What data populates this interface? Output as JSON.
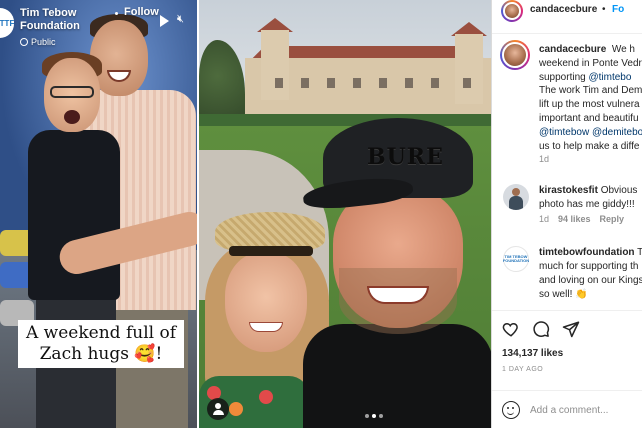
{
  "panel1": {
    "account_name": "Tim Tebow Foundation",
    "visibility": "Public",
    "follow_label": "Follow",
    "caption": "A weekend full of Zach hugs 🥰!",
    "avatar_mark": "TTF"
  },
  "panel2": {
    "cap_text": "BURE"
  },
  "panel3": {
    "header": {
      "username": "candacecbure",
      "separator": "•",
      "follow_label": "Fo"
    },
    "caption": {
      "username": "candacecbure",
      "lines": [
        [
          "We h"
        ],
        [
          "weekend in Ponte Vedr"
        ],
        [
          "supporting ",
          "@timtebo"
        ],
        [
          "The work Tim and Dem"
        ],
        [
          "lift up the most vulnera"
        ],
        [
          "important and beautifu"
        ],
        [
          "@timtebow @demitebo"
        ],
        [
          "us to help make a diffe"
        ]
      ],
      "time": "1d"
    },
    "comments": [
      {
        "username": "kirastokesfit",
        "text_lines": [
          "Obvious",
          "photo has me giddy!!!"
        ],
        "time": "1d",
        "likes": "94 likes",
        "reply_label": "Reply"
      },
      {
        "username": "timtebowfoundation",
        "avatar_mark": "TIM TEBOW FOUNDATION",
        "text_lines": [
          "T",
          "much for supporting th",
          "and loving on our Kings",
          "so well! 👏"
        ]
      }
    ],
    "likes": "134,137 likes",
    "date": "1 DAY AGO",
    "comment_placeholder": "Add a comment..."
  }
}
